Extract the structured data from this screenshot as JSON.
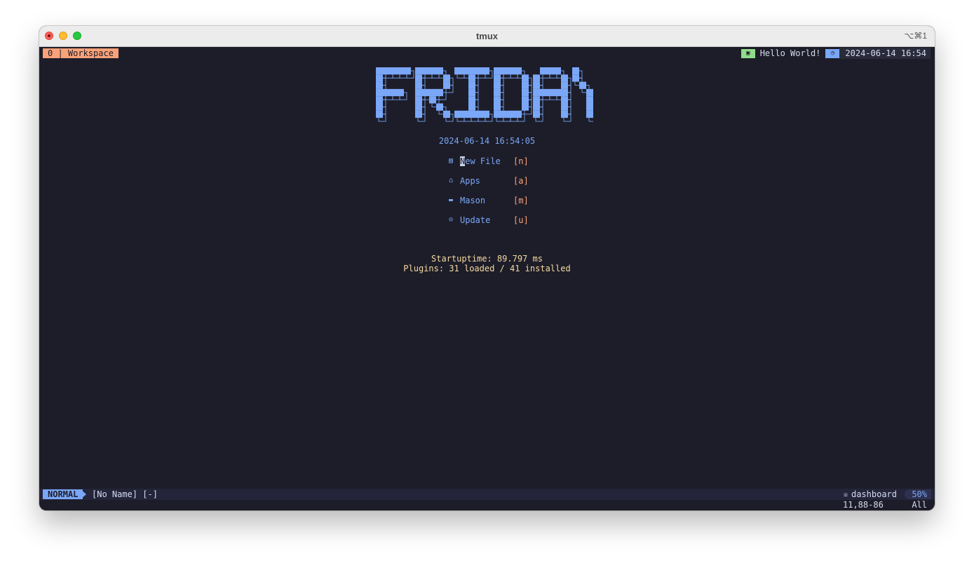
{
  "window": {
    "title": "tmux",
    "shortcut": "⌥⌘1"
  },
  "tmux": {
    "session_label": "0 | Workspace",
    "hello_icon": "▣",
    "hello_text": "Hello World!",
    "clock_icon": "◷",
    "datetime": "2024-06-14 16:54"
  },
  "dashboard": {
    "logo_text": "FRIDAY",
    "date": "2024-06-14 16:54:05",
    "menu": [
      {
        "icon": "▤",
        "label_first": "N",
        "label_rest": "ew File",
        "key": "[n]"
      },
      {
        "icon": "⌂",
        "label": "Apps",
        "key": "[a]"
      },
      {
        "icon": "▬",
        "label": "Mason",
        "key": "[m]"
      },
      {
        "icon": "⊙",
        "label": "Update",
        "key": "[u]"
      }
    ],
    "startuptime": "Startuptime: 89.797 ms",
    "plugins": "Plugins: 31 loaded / 41 installed"
  },
  "statusline": {
    "mode": "NORMAL",
    "buffer": "[No Name] [-]",
    "filetype_icon": "≡",
    "filetype": "dashboard",
    "percent": "50%",
    "position": "11,88-86",
    "scroll": "All"
  },
  "colors": {
    "background": "#1d1d29",
    "accent_blue": "#7aa7f7",
    "accent_orange": "#f9a27a",
    "accent_green": "#8fdc8a",
    "footer_yellow": "#f5d9a0"
  }
}
